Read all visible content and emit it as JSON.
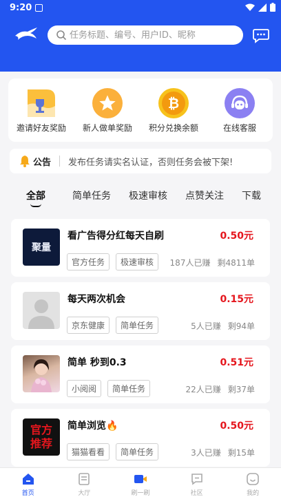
{
  "status_bar": {
    "time": "9:20"
  },
  "search": {
    "placeholder": "任务标题、编号、用户ID、昵称"
  },
  "quick_actions": [
    {
      "label": "邀请好友奖励",
      "icon": "invite-trophy-icon"
    },
    {
      "label": "新人做单奖励",
      "icon": "star-medal-icon"
    },
    {
      "label": "积分兑换余额",
      "icon": "bitcoin-coin-icon"
    },
    {
      "label": "在线客服",
      "icon": "customer-service-icon"
    }
  ],
  "notice": {
    "tag": "公告",
    "text": "发布任务请实名认证，否则任务会被下架!"
  },
  "tabs": [
    "全部",
    "简单任务",
    "极速审核",
    "点赞关注",
    "下载"
  ],
  "tasks": [
    {
      "title": "看广告得分红每天自刷",
      "price": "0.50元",
      "chips": [
        "官方任务",
        "极速审核"
      ],
      "earned": "187人已赚",
      "remaining": "剩4811单",
      "thumb_text": "聚量"
    },
    {
      "title": "每天两次机会",
      "price": "0.15元",
      "chips": [
        "京东健康",
        "简单任务"
      ],
      "earned": "5人已赚",
      "remaining": "剩94单",
      "thumb_text": ""
    },
    {
      "title": "简单 秒到0.3",
      "price": "0.51元",
      "chips": [
        "小阅阅",
        "简单任务"
      ],
      "earned": "22人已赚",
      "remaining": "剩37单",
      "thumb_text": ""
    },
    {
      "title": "简单浏览🔥",
      "price": "0.50元",
      "chips": [
        "猫猫看看",
        "简单任务"
      ],
      "earned": "3人已赚",
      "remaining": "剩15单",
      "thumb_text": "官方推荐"
    }
  ],
  "bottom_nav": [
    {
      "label": "首页",
      "icon": "home-icon"
    },
    {
      "label": "大厅",
      "icon": "hall-icon"
    },
    {
      "label": "刷一刷",
      "icon": "video-icon"
    },
    {
      "label": "社区",
      "icon": "community-icon"
    },
    {
      "label": "我的",
      "icon": "profile-icon"
    }
  ],
  "colors": {
    "brand": "#2355f0",
    "price": "#e5161d"
  }
}
